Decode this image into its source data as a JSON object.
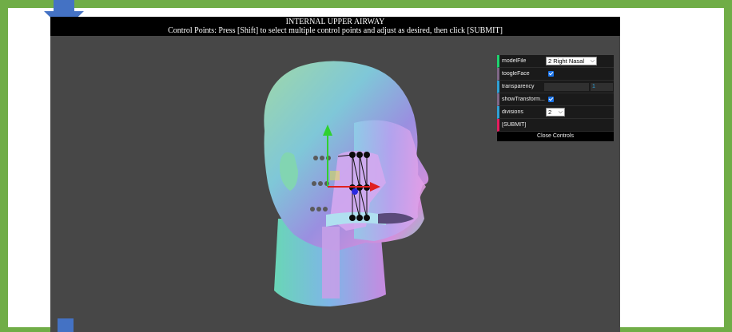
{
  "title": "INTERNAL UPPER AIRWAY",
  "instructions": "Control Points: Press [Shift] to select multiple control points and adjust as desired, then click [SUBMIT]",
  "gui": {
    "modelFile": {
      "label": "modelFile",
      "value": "2 Right Nasal"
    },
    "toggleFace": {
      "label": "toogleFace",
      "checked": true
    },
    "transparency": {
      "label": "transparency",
      "value": "1"
    },
    "showTransform": {
      "label": "showTransform...",
      "checked": true
    },
    "divisions": {
      "label": "divisions",
      "value": "2"
    },
    "submit": {
      "label": "[SUBMIT]"
    },
    "close": {
      "label": "Close Controls"
    }
  },
  "colors": {
    "frame": "#70ad47",
    "viewport_bg": "#474747",
    "marker": "#4472c4"
  }
}
